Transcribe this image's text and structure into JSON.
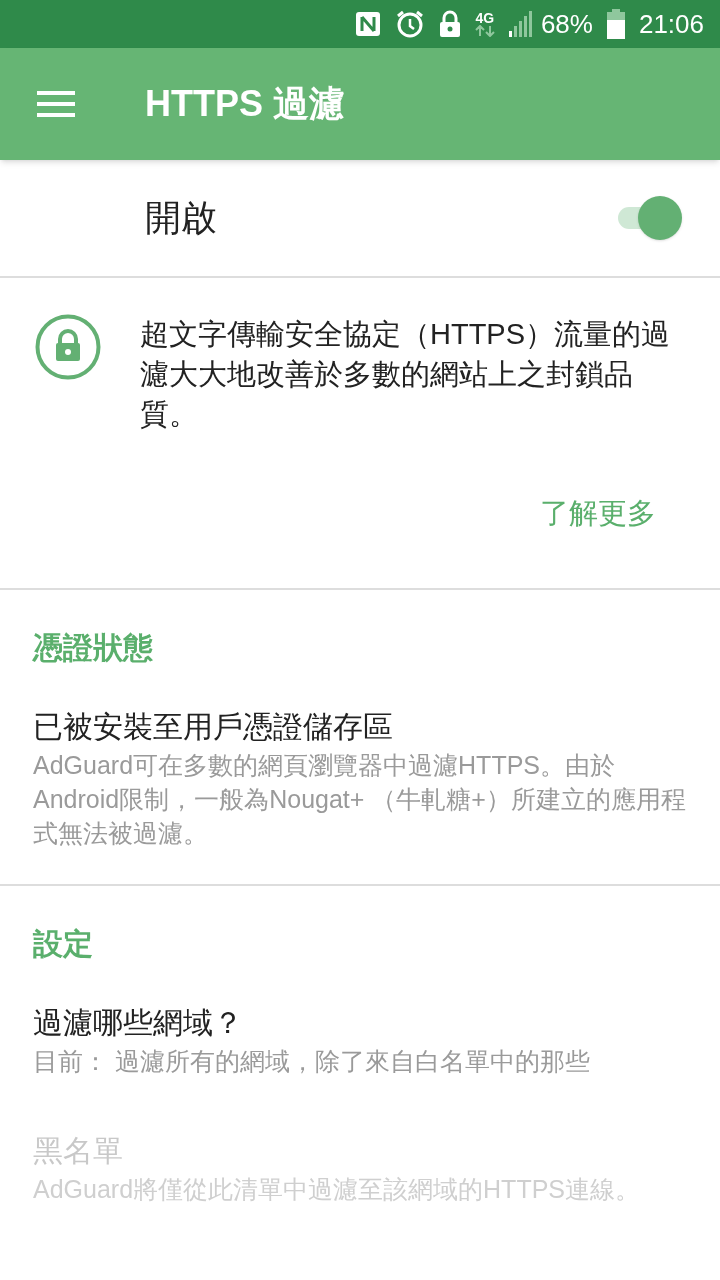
{
  "status_bar": {
    "network": "4G",
    "battery": "68%",
    "time": "21:06"
  },
  "toolbar": {
    "title": "HTTPS 過濾"
  },
  "main_switch": {
    "label": "開啟",
    "on": true
  },
  "info": {
    "text": "超文字傳輸安全協定（HTTPS）流量的過濾大大地改善於多數的網站上之封鎖品質。",
    "link": "了解更多"
  },
  "sections": [
    {
      "header": "憑證狀態",
      "items": [
        {
          "title": "已被安裝至用戶憑證儲存區",
          "subtitle": "AdGuard可在多數的網頁瀏覽器中過濾HTTPS。由於Android限制，一般為Nougat+ （牛軋糖+）所建立的應用程式無法被過濾。",
          "disabled": false
        }
      ]
    },
    {
      "header": "設定",
      "items": [
        {
          "title": "過濾哪些網域？",
          "subtitle": "目前： 過濾所有的網域，除了來自白名單中的那些",
          "disabled": false
        },
        {
          "title": "黑名單",
          "subtitle": "AdGuard將僅從此清單中過濾至該網域的HTTPS連線。",
          "disabled": true
        }
      ]
    }
  ]
}
